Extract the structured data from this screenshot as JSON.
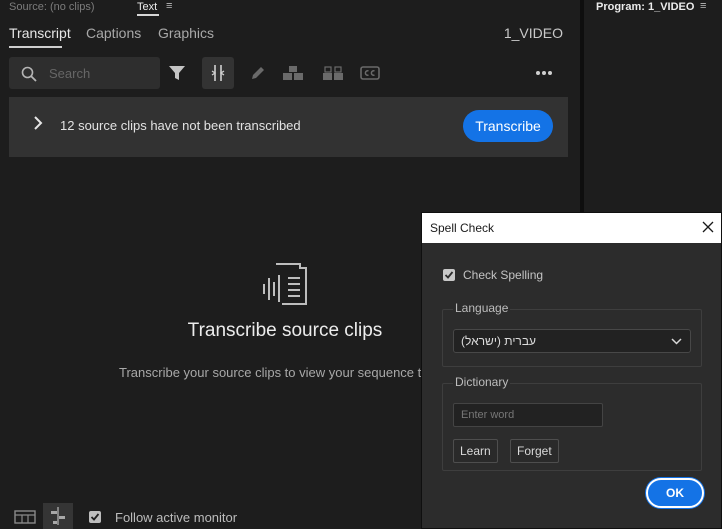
{
  "left_panel": {
    "source_tab": "Source: (no clips)",
    "text_tab": "Text",
    "menu_glyph": "≡",
    "subtabs": [
      "Transcript",
      "Captions",
      "Graphics"
    ],
    "sequence_name": "1_VIDEO",
    "search_placeholder": "Search",
    "notice_text": "12 source clips have not been transcribed",
    "transcribe_button": "Transcribe",
    "empty_title": "Transcribe source clips",
    "empty_desc": "Transcribe your source clips to view your sequence trans",
    "follow_label": "Follow active monitor"
  },
  "program_panel": {
    "title": "Program: 1_VIDEO",
    "menu_glyph": "≡"
  },
  "spell_check": {
    "title": "Spell Check",
    "check_spelling_label": "Check Spelling",
    "language_legend": "Language",
    "language_value": "עברית (ישראל)",
    "dictionary_legend": "Dictionary",
    "word_placeholder": "Enter word",
    "learn_button": "Learn",
    "forget_button": "Forget",
    "ok_button": "OK"
  },
  "colors": {
    "accent": "#1473e6",
    "panel_bg": "#1d1d1d",
    "dialog_bg": "#2c2c2c"
  }
}
